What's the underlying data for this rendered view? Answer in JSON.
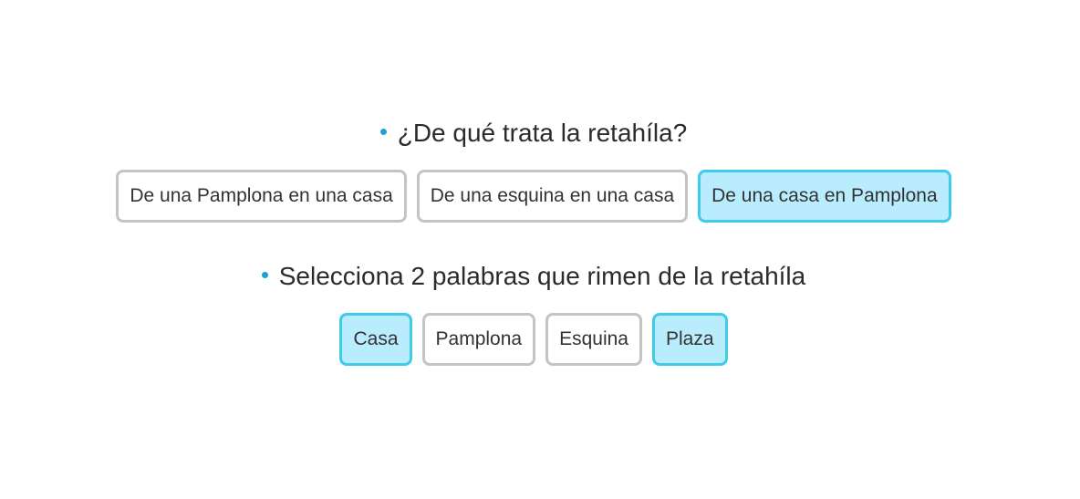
{
  "questions": [
    {
      "text": "¿De qué trata la retahíla?",
      "options": [
        {
          "label": "De una Pamplona en una casa",
          "selected": false
        },
        {
          "label": "De una esquina en una casa",
          "selected": false
        },
        {
          "label": "De una casa en Pamplona",
          "selected": true
        }
      ]
    },
    {
      "text": "Selecciona 2 palabras que rimen de la retahíla",
      "options": [
        {
          "label": "Casa",
          "selected": true
        },
        {
          "label": "Pamplona",
          "selected": false
        },
        {
          "label": "Esquina",
          "selected": false
        },
        {
          "label": "Plaza",
          "selected": true
        }
      ]
    }
  ],
  "colors": {
    "bullet": "#1e9fd6",
    "selected_background": "#b9edfd",
    "selected_border": "#3fcce8",
    "default_border": "#c4c4c4"
  }
}
